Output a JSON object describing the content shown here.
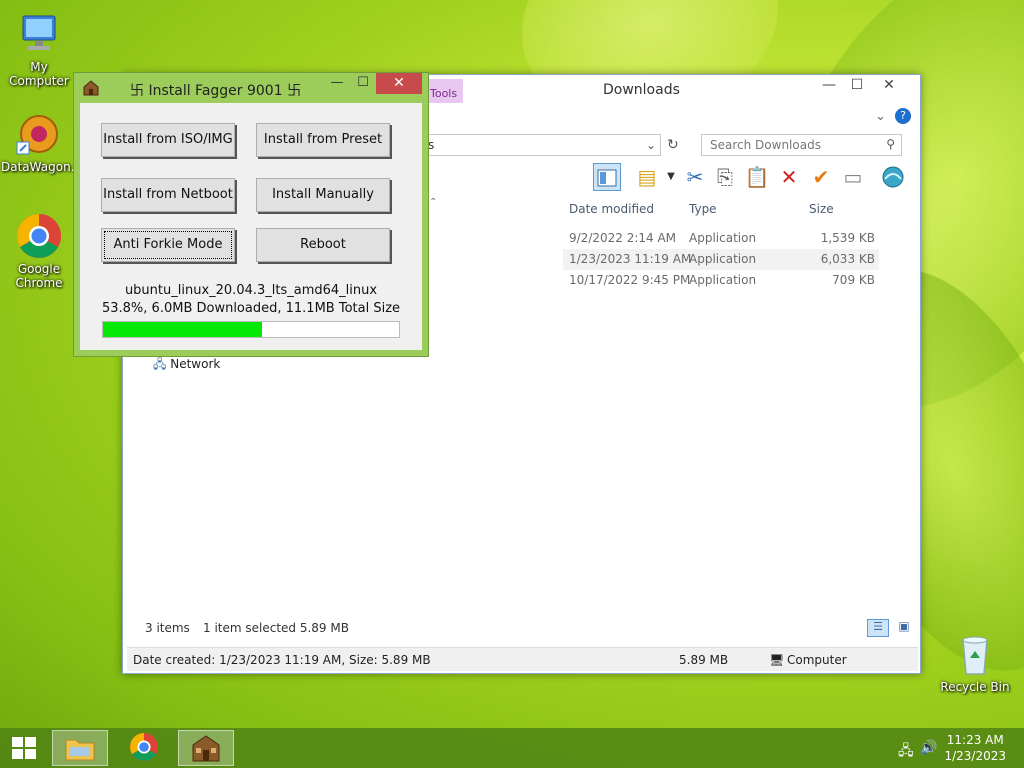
{
  "desktop": {
    "icons": [
      {
        "label": "My Computer"
      },
      {
        "label": "DataWagon..."
      },
      {
        "label": "Google Chrome"
      },
      {
        "label": "Recycle Bin"
      }
    ]
  },
  "explorer": {
    "title": "Downloads",
    "ribbon_tab": "Tools",
    "address_tail": "s",
    "search_placeholder": "Search Downloads",
    "minimize": "—",
    "maximize": "☐",
    "close": "✕",
    "columns": {
      "date": "Date modified",
      "type": "Type",
      "size": "Size"
    },
    "rows": [
      {
        "date": "9/2/2022 2:14 AM",
        "type": "Application",
        "size": "1,539 KB",
        "selected": false
      },
      {
        "date": "1/23/2023 11:19 AM",
        "type": "Application",
        "size": "6,033 KB",
        "selected": true
      },
      {
        "date": "10/17/2022 9:45 PM",
        "type": "Application",
        "size": "709 KB",
        "selected": false
      }
    ],
    "nav_network": "Network",
    "status": {
      "items": "3 items",
      "selected": "1 item selected  5.89 MB"
    },
    "details": {
      "created": "Date created: 1/23/2023 11:19 AM, Size: 5.89 MB",
      "size": "5.89 MB",
      "location": "Computer"
    }
  },
  "installer": {
    "title": "Install Fagger 9001",
    "title_glyph_left": "卐",
    "title_glyph_right": "卐",
    "buttons": {
      "iso": "Install from ISO/IMG",
      "preset": "Install from Preset",
      "netboot": "Install from Netboot",
      "manual": "Install Manually",
      "forkie": "Anti Forkie Mode",
      "reboot": "Reboot"
    },
    "download_name": "ubuntu_linux_20.04.3_lts_amd64_linux",
    "download_progress_text": "53.8%, 6.0MB Downloaded, 11.1MB Total Size",
    "progress_fraction": 0.538,
    "minimize": "—",
    "maximize": "☐",
    "close": "✕"
  },
  "taskbar": {
    "time": "11:23 AM",
    "date": "1/23/2023"
  },
  "colors": {
    "progress": "#06e806",
    "dialog_frame": "#9ccc5a",
    "close_button": "#c74b4b"
  }
}
